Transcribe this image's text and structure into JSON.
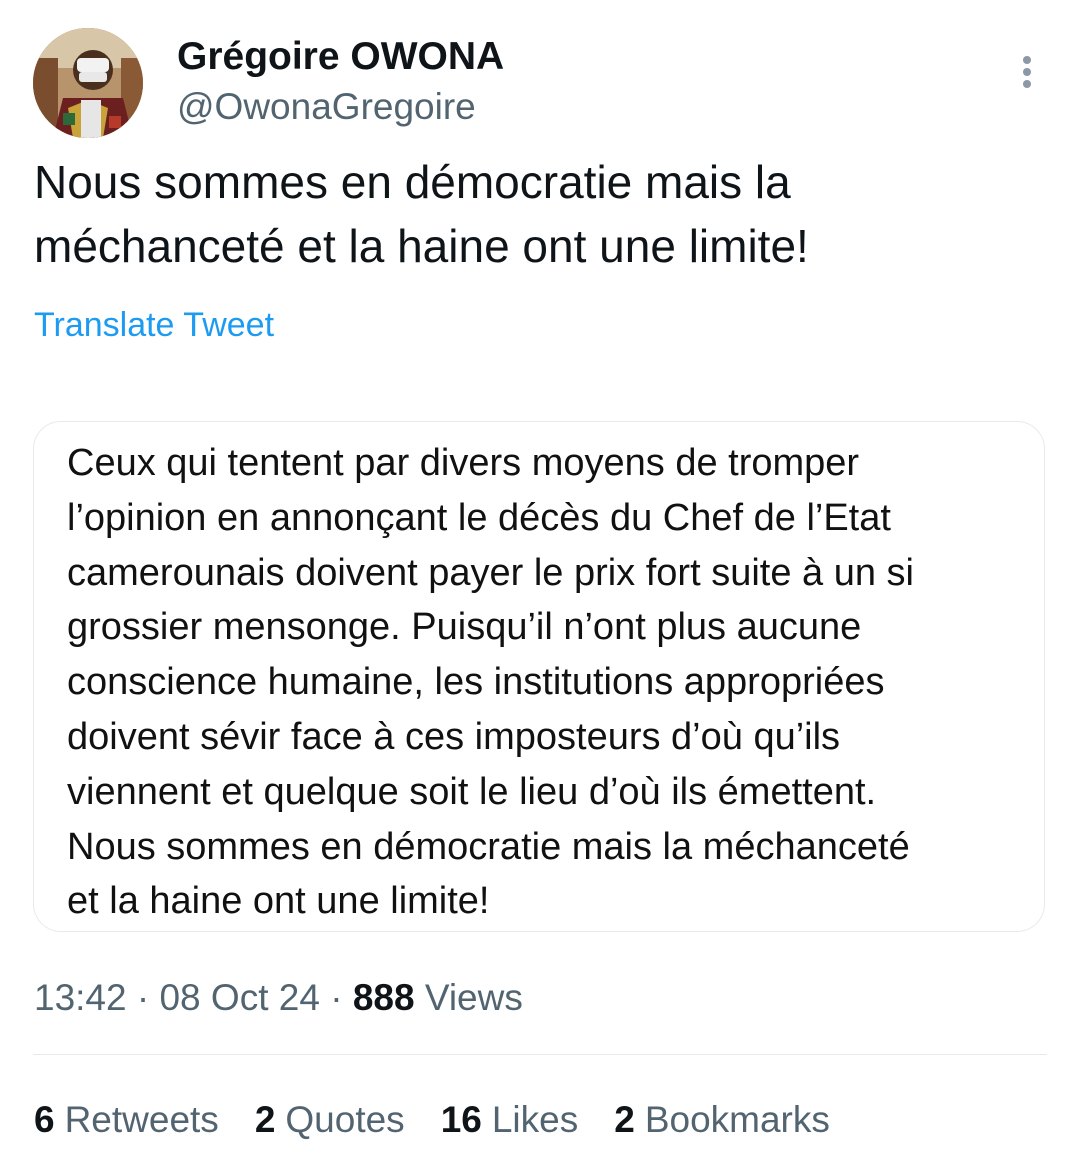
{
  "author": {
    "display_name": "Grégoire OWONA",
    "handle": "@OwonaGregoire"
  },
  "tweet": {
    "text": "Nous sommes en démocratie mais la\nméchanceté et la haine ont une limite!",
    "translate_label": "Translate Tweet"
  },
  "quoted_image_text": "Ceux qui tentent par divers moyens de tromper\nl’opinion en annonçant le décès du Chef de l’Etat\ncamerounais doivent payer le prix fort suite à un si\ngrossier mensonge. Puisqu’il n’ont plus aucune\nconscience humaine, les institutions appropriées\ndoivent sévir face à ces imposteurs d’où qu’ils\nviennent et quelque soit le lieu d’où ils émettent.\nNous sommes en démocratie mais la méchanceté\net la haine ont une limite!",
  "meta": {
    "time": "13:42",
    "sep1": " · ",
    "date": "08 Oct 24",
    "sep2": " · ",
    "views_count": "888",
    "views_label": "Views"
  },
  "stats": [
    {
      "count": "6",
      "label": "Retweets"
    },
    {
      "count": "2",
      "label": "Quotes"
    },
    {
      "count": "16",
      "label": "Likes"
    },
    {
      "count": "2",
      "label": "Bookmarks"
    }
  ],
  "icons": {
    "more": "more-vertical-icon"
  }
}
